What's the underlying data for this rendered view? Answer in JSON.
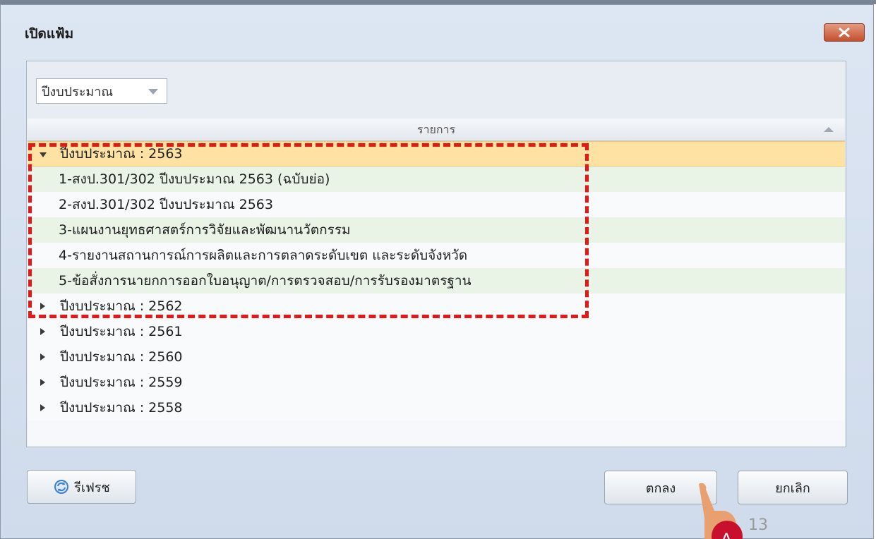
{
  "window": {
    "title": "เปิดแฟ้ม"
  },
  "filter": {
    "selected": "ปีงบประมาณ"
  },
  "grid": {
    "column_header": "รายการ",
    "expanded_group": "ปีงบประมาณ : 2563",
    "children": [
      "1-สงป.301/302 ปีงบประมาณ 2563 (ฉบับย่อ)",
      "2-สงป.301/302 ปีงบประมาณ 2563",
      "3-แผนงานยุทธศาสตร์การวิจัยและพัฒนานวัตกรรม",
      "4-รายงานสถานการณ์การผลิตและการตลาดระดับเขต และระดับจังหวัด",
      "5-ข้อสั่งการนายกการออกใบอนุญาต/การตรวจสอบ/การรับรองมาตรฐาน"
    ],
    "collapsed_groups": [
      "ปีงบประมาณ : 2562",
      "ปีงบประมาณ : 2561",
      "ปีงบประมาณ : 2560",
      "ปีงบประมาณ : 2559",
      "ปีงบประมาณ : 2558"
    ]
  },
  "buttons": {
    "refresh": "รีเฟรช",
    "ok": "ตกลง",
    "cancel": "ยกเลิก"
  },
  "annotation": {
    "marker": "A",
    "page_number": "13"
  },
  "colors": {
    "highlight_box": "#e41818",
    "selected_row": "#fde2a4",
    "hand": "#e8a070"
  }
}
